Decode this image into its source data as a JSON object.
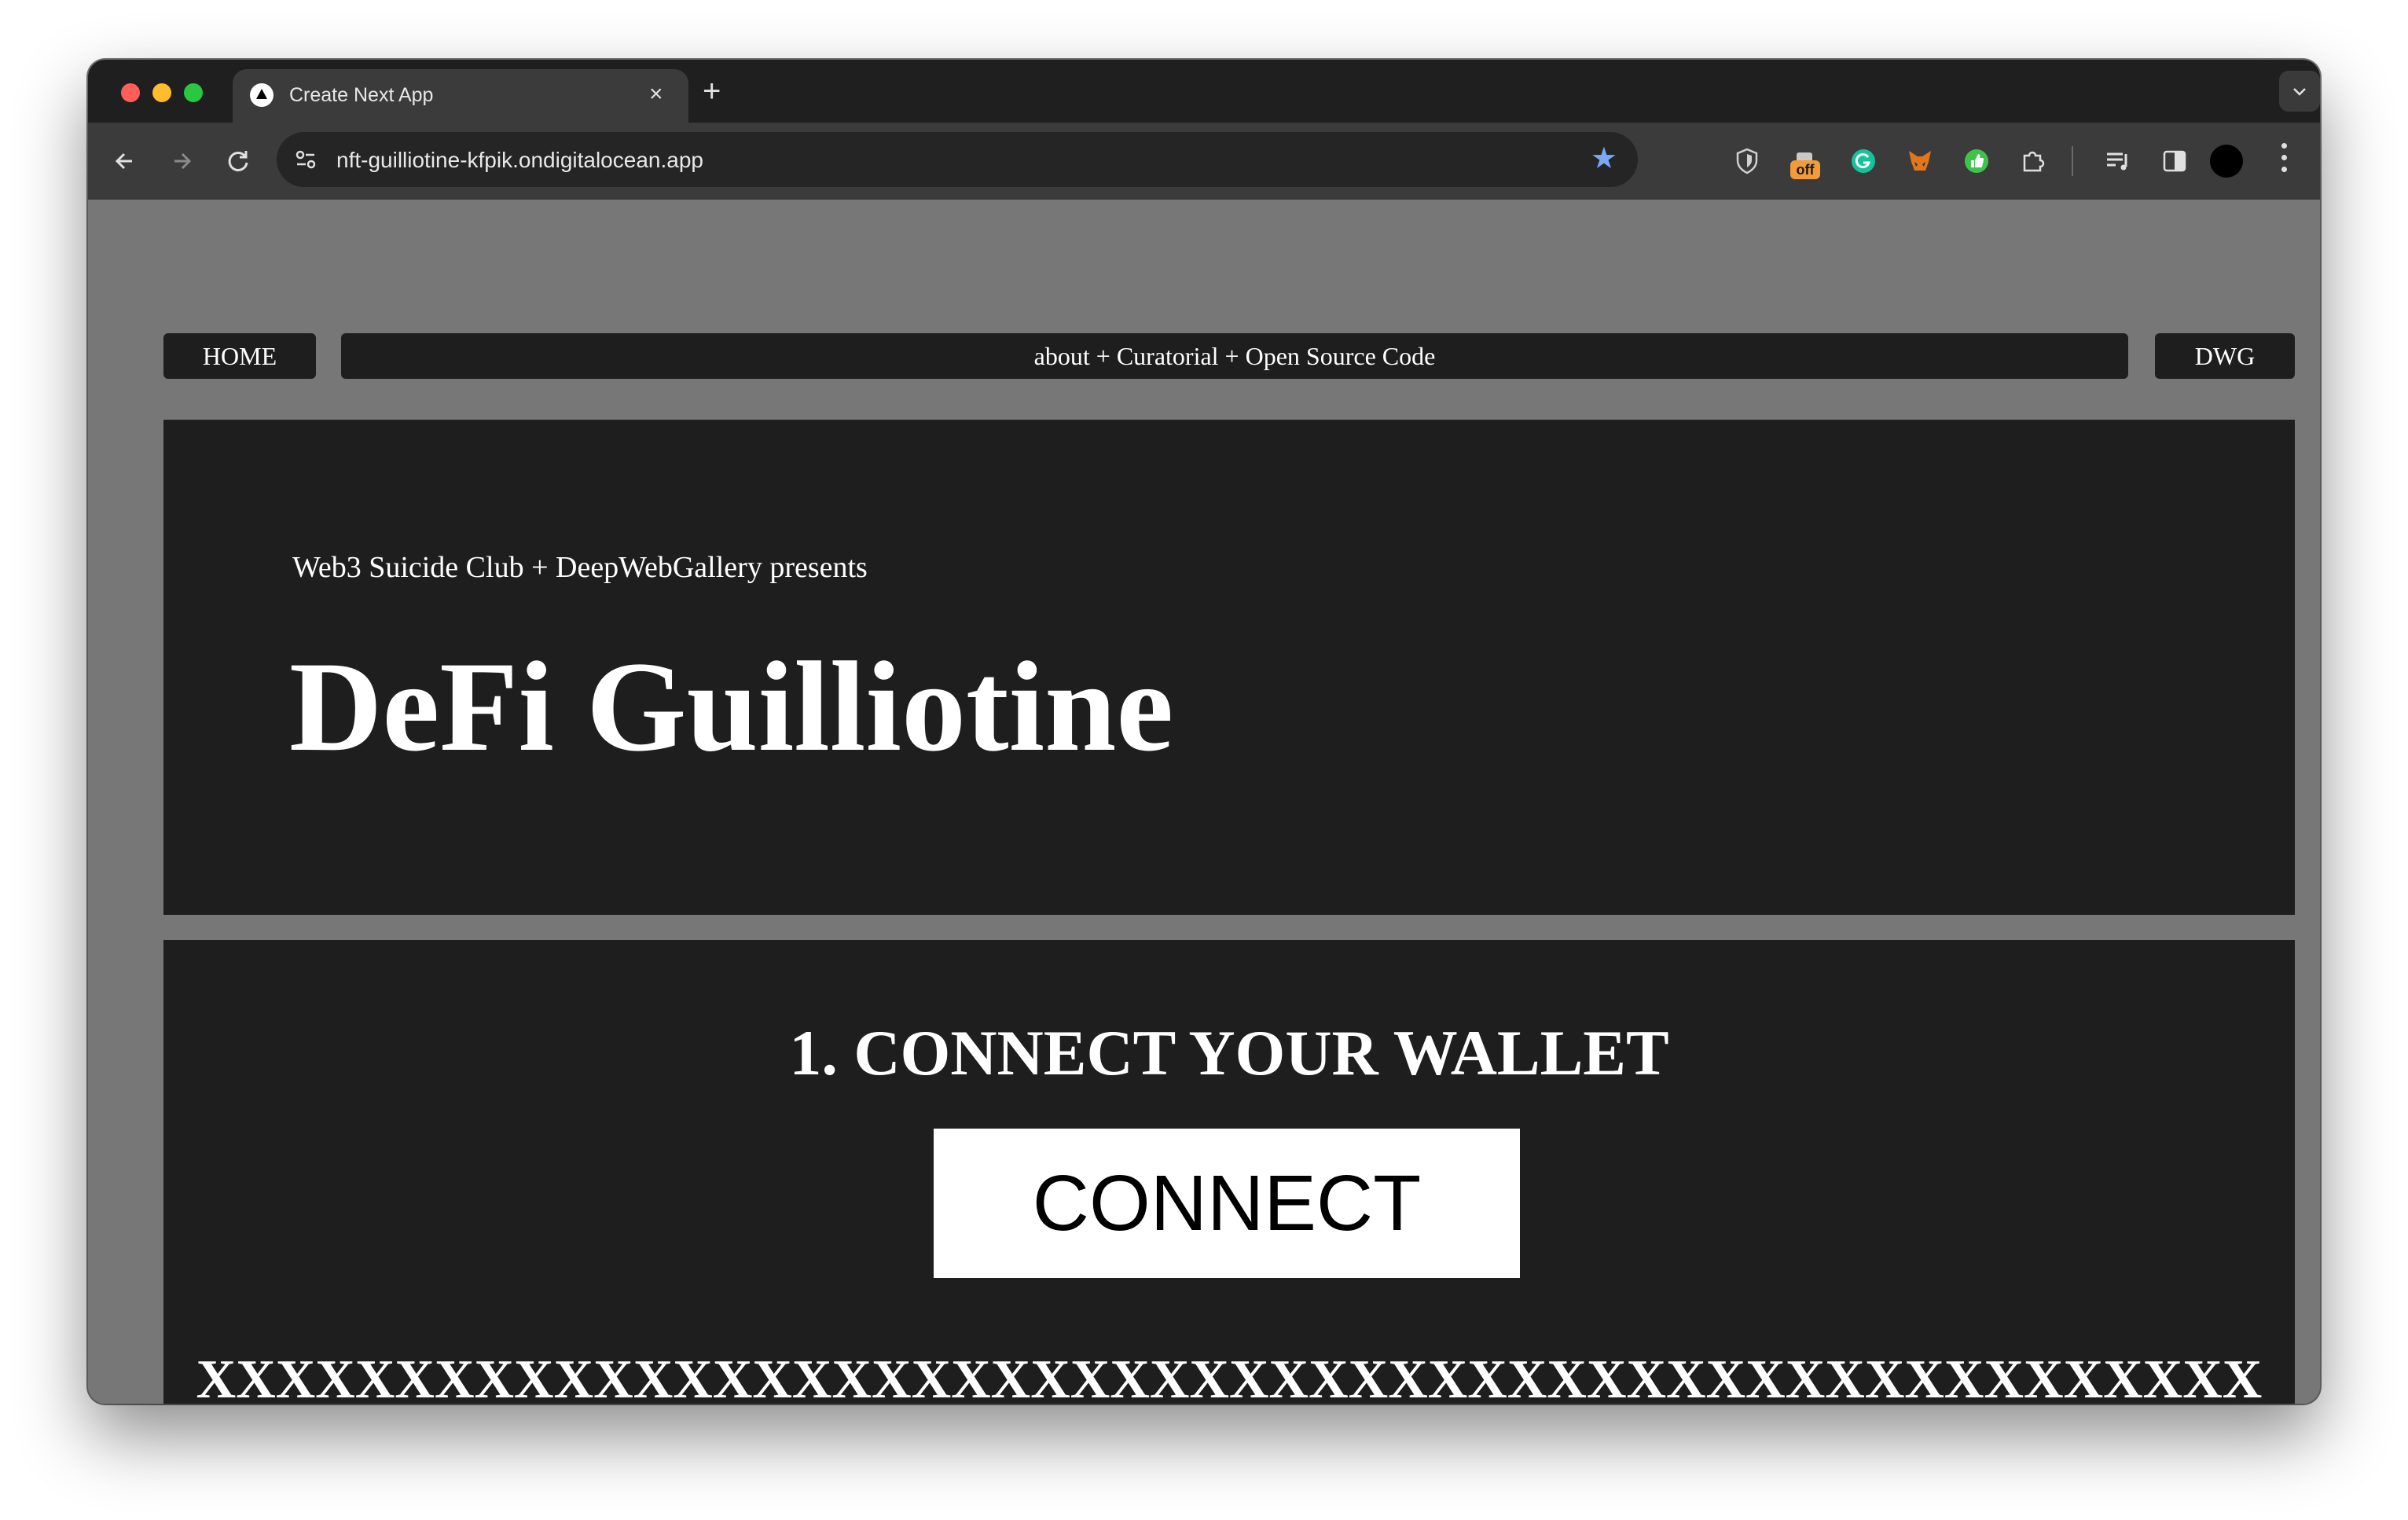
{
  "browser": {
    "tab_title": "Create Next App",
    "tab_close": "×",
    "new_tab": "+",
    "url": "nft-guilliotine-kfpik.ondigitalocean.app",
    "bookmark_star": "★",
    "extensions": [
      "shield-icon",
      "off-badge-extension-icon",
      "grammarly-icon",
      "metamask-fox-icon",
      "green-thumb-extension-icon",
      "puzzle-extensions-icon",
      "media-queue-icon",
      "side-panel-icon"
    ],
    "extension_badge": "off",
    "accent_color": "#7aa7f7"
  },
  "nav": {
    "home": "HOME",
    "about": "about + Curatorial + Open Source Code",
    "dwg": "DWG"
  },
  "hero": {
    "presents": "Web3 Suicide Club + DeepWebGallery presents",
    "title": "DeFi Guilliotine"
  },
  "connect": {
    "heading": "1. CONNECT YOUR WALLET",
    "button": "CONNECT",
    "placeholder_line": "XXXXXXXXXXXXXXXXXXXXXXXXXXXXXXXXXXXXXXXXXXXXXXXXXXXX"
  },
  "colors": {
    "page_background": "#777777",
    "panel_background": "#1e1e1e",
    "text": "#ffffff"
  }
}
